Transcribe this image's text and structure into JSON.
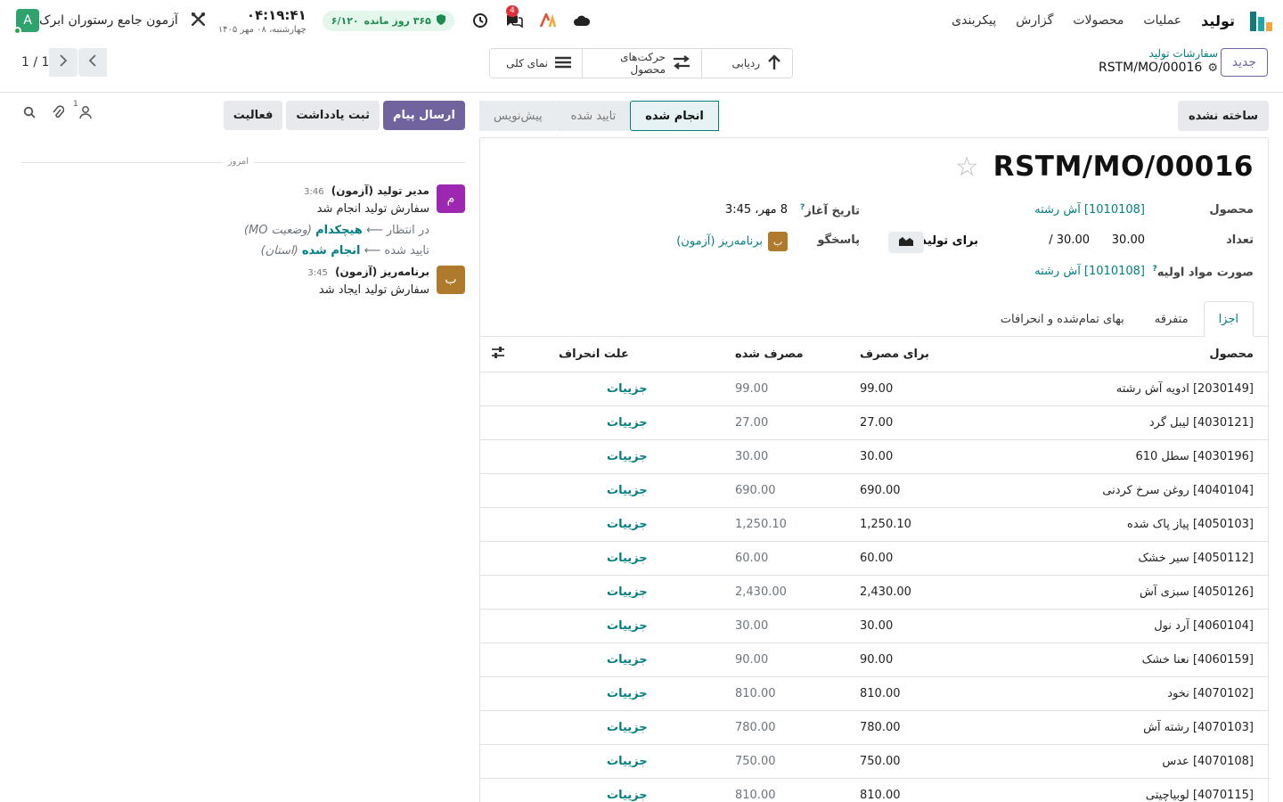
{
  "navbar": {
    "app_name": "تولید",
    "menu": [
      "عملیات",
      "محصولات",
      "گزارش",
      "پیکربندی"
    ],
    "company": "آزمون جامع رستوران ابرک",
    "user_initial": "A",
    "clock_time": "۰۴:۱۹:۴۱",
    "clock_date": "چهارشنبه، ۰۸ مهر ۱۴۰۵",
    "subscription": "۳۶۵ روز مانده",
    "subscription_ratio": "۶/۱۲۰",
    "message_count": "4",
    "colors": {
      "brand": "#71639e",
      "link": "#017e84",
      "user": "#2fa36b",
      "success_badge": "#1d8a4e"
    }
  },
  "control_panel": {
    "new_label": "جدید",
    "breadcrumb_parent": "سفارشات تولید",
    "breadcrumb_current": "RSTM/MO/00016",
    "smart_buttons": [
      "ردیابی",
      "حرکت‌های محصول",
      "نمای کلی"
    ],
    "pager": "1 / 1"
  },
  "statusbar": {
    "unbuild_label": "ساخته نشده",
    "stages": [
      "پیش‌نویس",
      "تایید شده",
      "انجام شده"
    ],
    "active_stage": "انجام شده"
  },
  "form": {
    "title": "RSTM/MO/00016",
    "product_label": "محصول",
    "product_value": "[1010108] آش رشته",
    "quantity_label": "تعداد",
    "qty_produced": "30.00",
    "qty_total": "30.00 /",
    "to_produce_label": "برای تولید",
    "bom_label": "صورت مواد اولیه",
    "bom_value": "[1010108] آش رشته",
    "start_date_label": "تاریخ آغاز",
    "start_date_value": "8 مهر، 3:45",
    "responsible_label": "پاسخگو",
    "responsible_value": "برنامه‌ریز (آزمون)",
    "responsible_initial": "ب"
  },
  "tabs": [
    "اجزا",
    "متفرقه",
    "بهای تمام‌شده و انحرافات"
  ],
  "table": {
    "headers": {
      "product": "محصول",
      "to_consume": "برای مصرف",
      "consumed": "مصرف شده",
      "deviation": "علت انحراف"
    },
    "rows": [
      {
        "product": "[2030149] ادویه آش رشته",
        "to_consume": "99.00",
        "consumed": "99.00",
        "action": "جزییات"
      },
      {
        "product": "[4030121] لیبل گرد",
        "to_consume": "27.00",
        "consumed": "27.00",
        "action": "جزییات"
      },
      {
        "product": "[4030196] سطل 610",
        "to_consume": "30.00",
        "consumed": "30.00",
        "action": "جزییات"
      },
      {
        "product": "[4040104] روغن سرخ کردنی",
        "to_consume": "690.00",
        "consumed": "690.00",
        "action": "جزییات"
      },
      {
        "product": "[4050103] پیاز پاک شده",
        "to_consume": "1,250.10",
        "consumed": "1,250.10",
        "action": "جزییات"
      },
      {
        "product": "[4050112] سیر خشک",
        "to_consume": "60.00",
        "consumed": "60.00",
        "action": "جزییات"
      },
      {
        "product": "[4050126] سبزی آش",
        "to_consume": "2,430.00",
        "consumed": "2,430.00",
        "action": "جزییات"
      },
      {
        "product": "[4060104] آرد نول",
        "to_consume": "30.00",
        "consumed": "30.00",
        "action": "جزییات"
      },
      {
        "product": "[4060159] نعنا خشک",
        "to_consume": "90.00",
        "consumed": "90.00",
        "action": "جزییات"
      },
      {
        "product": "[4070102] نخود",
        "to_consume": "810.00",
        "consumed": "810.00",
        "action": "جزییات"
      },
      {
        "product": "[4070103] رشته آش",
        "to_consume": "780.00",
        "consumed": "780.00",
        "action": "جزییات"
      },
      {
        "product": "[4070108] عدس",
        "to_consume": "750.00",
        "consumed": "750.00",
        "action": "جزییات"
      },
      {
        "product": "[4070115] لوبیاچیتی",
        "to_consume": "810.00",
        "consumed": "810.00",
        "action": "جزییات"
      }
    ]
  },
  "chatter": {
    "send_message": "ارسال پیام",
    "log_note": "ثبت یادداشت",
    "activity": "فعالیت",
    "follower_count": "1",
    "date_separator": "امروز",
    "messages": [
      {
        "author": "مدیر تولید (آزمون)",
        "time": "3:46",
        "initial": "م",
        "text": "سفارش تولید انجام شد",
        "tracking": [
          {
            "old": "در انتظار",
            "new": "هیچکدام",
            "field": "(وضعیت MO)"
          },
          {
            "old": "تایید شده",
            "new": "انجام شده",
            "field": "(استان)"
          }
        ]
      },
      {
        "author": "برنامه‌ریز (آزمون)",
        "time": "3:45",
        "initial": "ب",
        "text": "سفارش تولید ایجاد شد"
      }
    ]
  }
}
